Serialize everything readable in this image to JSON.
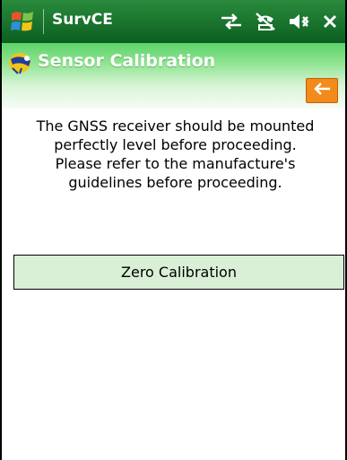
{
  "statusbar": {
    "app_name": "SurvCE",
    "icons": [
      "windows-start-icon",
      "connectivity-icon",
      "phone-off-icon",
      "volume-mute-icon",
      "close-icon"
    ]
  },
  "header": {
    "title": "Sensor Calibration",
    "title_icon": "survey-instrument-icon",
    "back_icon": "arrow-left-icon"
  },
  "main": {
    "message": "The GNSS receiver should be mounted\nperfectly level before proceeding.\nPlease refer to the manufacture's\nguidelines before proceeding.",
    "zero_button_label": "Zero Calibration"
  },
  "colors": {
    "statusbar": "#0b5f20",
    "title_gradient_top": "#5dd36a",
    "back_button": "#f28a1c",
    "button_bg": "#d9f0d6"
  }
}
